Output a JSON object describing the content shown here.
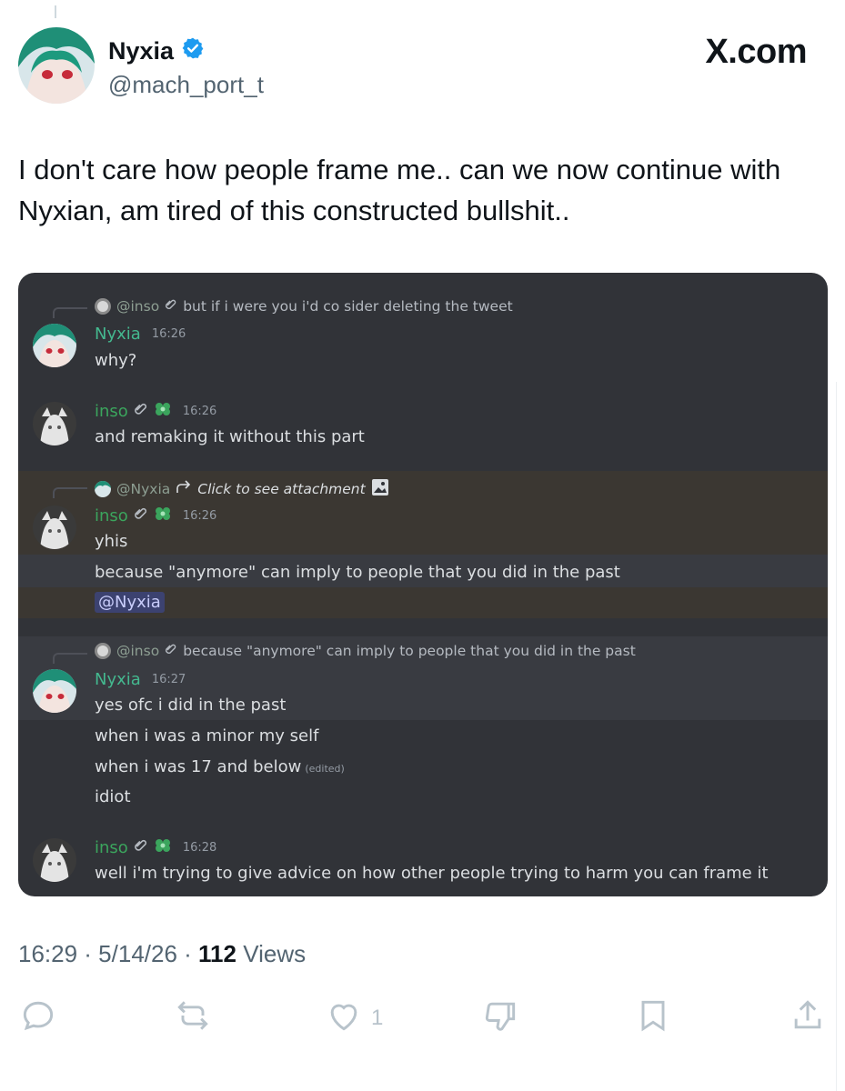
{
  "tweet": {
    "display_name": "Nyxia",
    "handle": "@mach_port_t",
    "brand": "X.com",
    "text": "I don't care how people frame me.. can we now continue with Nyxian, am tired of this constructed bullshit..",
    "timestamp": "16:29 · 5/14/26 · ",
    "views_count": "112",
    "views_label": " Views",
    "like_count": "1"
  },
  "discord": {
    "messages": [
      {
        "reply_name": "@inso",
        "reply_text": "but if i were you i'd co sider deleting the tweet",
        "author": "Nyxia",
        "time": "16:26",
        "lines": [
          "why?"
        ]
      },
      {
        "author": "inso",
        "time": "16:26",
        "lines": [
          "and remaking it without this part"
        ]
      },
      {
        "reply_name": "@Nyxia",
        "reply_text": "Click to see attachment",
        "author": "inso",
        "time": "16:26",
        "lines": [
          "yhis",
          "because \"anymore\" can imply to people that you did in the past",
          "@Nyxia"
        ]
      },
      {
        "reply_name": "@inso",
        "reply_text": "because \"anymore\" can imply to people that you did in the past",
        "author": "Nyxia",
        "time": "16:27",
        "lines": [
          "yes ofc i did in the past",
          "when i was a minor my self",
          "when i was 17 and below",
          "idiot"
        ],
        "edited": "(edited)"
      },
      {
        "author": "inso",
        "time": "16:28",
        "lines": [
          "well i'm trying to give advice on how other people trying to harm you can frame it"
        ]
      }
    ]
  },
  "colors": {
    "discord_bg": "#313338",
    "highlight_bg": "#3b3732",
    "name_green": "#3ba55d",
    "verified_blue": "#1d9bf0"
  },
  "icons": [
    "verified-badge-icon",
    "reply-icon",
    "repost-icon",
    "like-icon",
    "dislike-icon",
    "bookmark-icon",
    "share-icon",
    "paperclip-icon",
    "server-badge-icon",
    "image-icon",
    "reply-arrow-icon"
  ]
}
